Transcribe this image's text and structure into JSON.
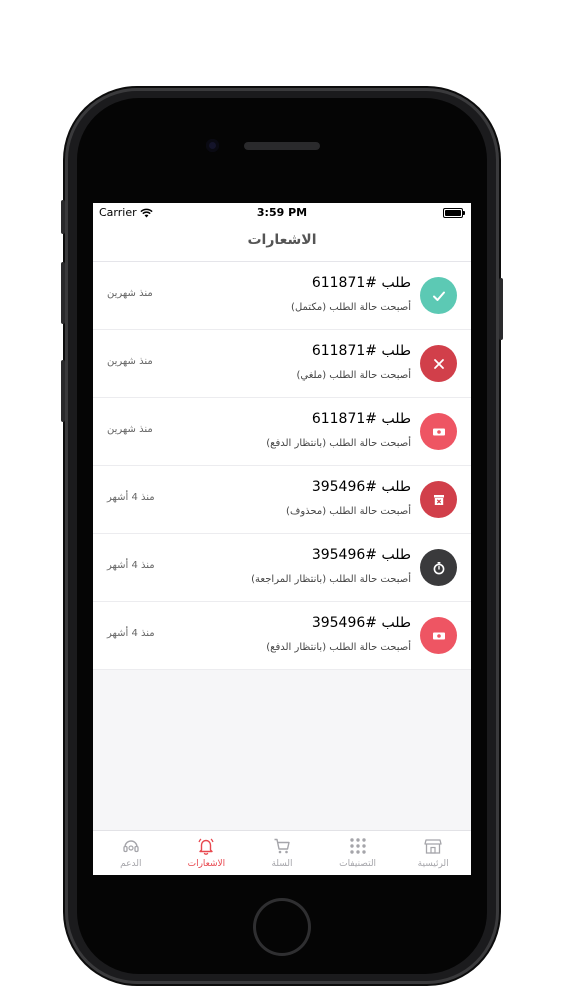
{
  "status_bar": {
    "carrier": "Carrier",
    "time": "3:59 PM"
  },
  "header": {
    "title": "الاشعارات"
  },
  "colors": {
    "teal": "#5cc9b4",
    "red": "#d13f4a",
    "pink": "#ee5563",
    "dark": "#3a3a3c",
    "active_tab": "#e8484f",
    "inactive_tab": "#a5a5aa"
  },
  "notifications": [
    {
      "title": "طلب #611871",
      "subtitle": "أصبحت حالة الطلب (مكتمل)",
      "time": "منذ شهرين",
      "icon": "check-icon",
      "color": "#5cc9b4"
    },
    {
      "title": "طلب #611871",
      "subtitle": "أصبحت حالة الطلب (ملغي)",
      "time": "منذ شهرين",
      "icon": "close-icon",
      "color": "#d13f4a"
    },
    {
      "title": "طلب #611871",
      "subtitle": "أصبحت حالة الطلب (بانتظار الدفع)",
      "time": "منذ شهرين",
      "icon": "money-icon",
      "color": "#ee5563"
    },
    {
      "title": "طلب #395496",
      "subtitle": "أصبحت حالة الطلب (محذوف)",
      "time": "منذ 4 أشهر",
      "icon": "deleted-box-icon",
      "color": "#d13f4a"
    },
    {
      "title": "طلب #395496",
      "subtitle": "أصبحت حالة الطلب (بانتظار المراجعة)",
      "time": "منذ 4 أشهر",
      "icon": "stopwatch-icon",
      "color": "#3a3a3c"
    },
    {
      "title": "طلب #395496",
      "subtitle": "أصبحت حالة الطلب (بانتظار الدفع)",
      "time": "منذ 4 أشهر",
      "icon": "money-icon",
      "color": "#ee5563"
    }
  ],
  "tabs": [
    {
      "label": "الدعم",
      "icon": "headset-icon",
      "active": false
    },
    {
      "label": "الاشعارات",
      "icon": "bell-icon",
      "active": true
    },
    {
      "label": "السلة",
      "icon": "cart-icon",
      "active": false
    },
    {
      "label": "التصنيفات",
      "icon": "grid-icon",
      "active": false
    },
    {
      "label": "الرئيسية",
      "icon": "store-icon",
      "active": false
    }
  ]
}
